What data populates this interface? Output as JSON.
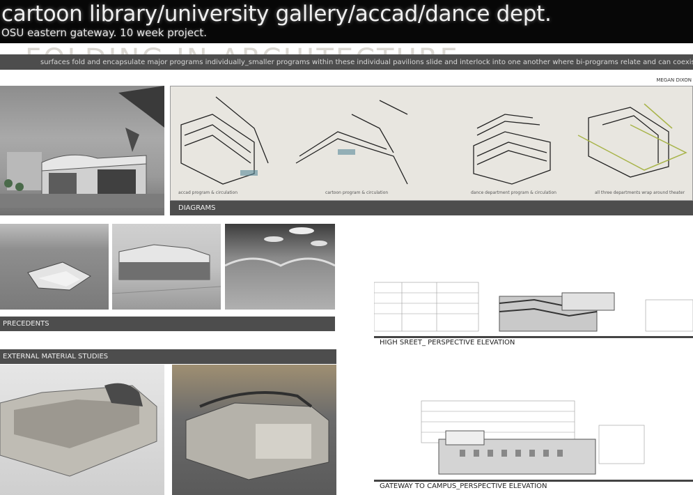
{
  "header": {
    "title": "cartoon library/university gallery/accad/dance dept.",
    "subtitle": "OSU eastern gateway. 10 week project."
  },
  "ghost_title": "FOLDING IN ARCHITECTURE",
  "banner_text": "surfaces fold and encapsulate major programs individually_smaller programs within these individual pavilions slide and interlock into one another where bi-programs relate and can coexist",
  "author": "MEGAN DIXON",
  "diagrams": {
    "title": "DIAGRAMS",
    "labels": [
      "accad program & circulation",
      "cartoon program & circulation",
      "dance department program & circulation",
      "all three departments wrap around theater"
    ]
  },
  "precedents_title": "PRECEDENTS",
  "material_title": "EXTERNAL MATERIAL STUDIES",
  "elevations": {
    "high_street": "HIGH SREET_ PERSPECTIVE ELEVATION",
    "gateway": "GATEWAY TO CAMPUS_PERSPECTIVE ELEVATION"
  },
  "colors": {
    "accent_green": "#a8b44a",
    "bar_gray": "#4d4d4d",
    "header_black": "#070707"
  }
}
